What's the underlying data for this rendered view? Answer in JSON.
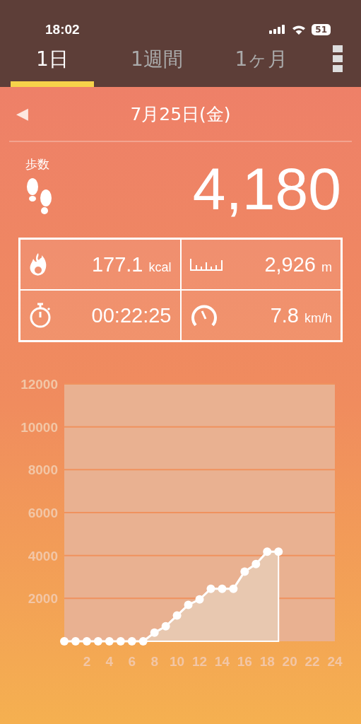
{
  "status_bar": {
    "time": "18:02",
    "battery": "51"
  },
  "tabs": [
    {
      "label": "1日",
      "selected": true
    },
    {
      "label": "1週間",
      "selected": false
    },
    {
      "label": "1ヶ月",
      "selected": false
    }
  ],
  "date_nav": {
    "prev": "◀",
    "date": "7月25日(金)"
  },
  "steps": {
    "label": "歩数",
    "value": "4,180"
  },
  "stats": [
    {
      "kind": "calories",
      "value": "177.1",
      "unit": "kcal"
    },
    {
      "kind": "distance",
      "value": "2,926",
      "unit": "m"
    },
    {
      "kind": "time",
      "value": "00:22:25"
    },
    {
      "kind": "speed",
      "value": "7.8",
      "unit": "km/h"
    }
  ],
  "chart_data": {
    "type": "area",
    "x": [
      0,
      1,
      2,
      3,
      4,
      5,
      6,
      7,
      8,
      9,
      10,
      11,
      12,
      13,
      14,
      15,
      16,
      17,
      18,
      19
    ],
    "series": [
      {
        "color": "#ffffff",
        "values": [
          0,
          0,
          0,
          0,
          0,
          0,
          0,
          0,
          400,
          700,
          1200,
          1700,
          1950,
          2450,
          2450,
          2450,
          3250,
          3600,
          4180,
          4180
        ]
      }
    ],
    "xlim": [
      0,
      24
    ],
    "ylim": [
      0,
      12000
    ],
    "xticks": [
      2,
      4,
      6,
      8,
      10,
      12,
      14,
      16,
      18,
      20,
      22,
      24
    ],
    "yticks": [
      2000,
      4000,
      6000,
      8000,
      10000,
      12000
    ],
    "grid": true
  }
}
